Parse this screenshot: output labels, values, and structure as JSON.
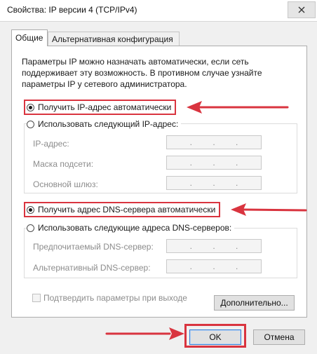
{
  "window": {
    "title": "Свойства: IP версии 4 (TCP/IPv4)",
    "close_icon": "close-icon"
  },
  "tabs": [
    {
      "label": "Общие",
      "active": true
    },
    {
      "label": "Альтернативная конфигурация",
      "active": false
    }
  ],
  "description": "Параметры IP можно назначать автоматически, если сеть поддерживает эту возможность. В противном случае узнайте параметры IP у сетевого администратора.",
  "ip_section": {
    "auto_label": "Получить IP-адрес автоматически",
    "auto_selected": true,
    "manual_label": "Использовать следующий IP-адрес:",
    "manual_selected": false,
    "fields": [
      {
        "label": "IP-адрес:",
        "value": ".   .   ."
      },
      {
        "label": "Маска подсети:",
        "value": ".   .   ."
      },
      {
        "label": "Основной шлюз:",
        "value": ".   .   ."
      }
    ]
  },
  "dns_section": {
    "auto_label": "Получить адрес DNS-сервера автоматически",
    "auto_selected": true,
    "manual_label": "Использовать следующие адреса DNS-серверов:",
    "manual_selected": false,
    "fields": [
      {
        "label": "Предпочитаемый DNS-сервер:",
        "value": ".   .   ."
      },
      {
        "label": "Альтернативный DNS-сервер:",
        "value": ".   .   ."
      }
    ]
  },
  "validate_checkbox": {
    "label": "Подтвердить параметры при выходе",
    "checked": false
  },
  "buttons": {
    "advanced": "Дополнительно...",
    "ok": "OK",
    "cancel": "Отмена"
  },
  "colors": {
    "annotation": "#d9343f",
    "dialog_bg": "#f0f0f0"
  }
}
